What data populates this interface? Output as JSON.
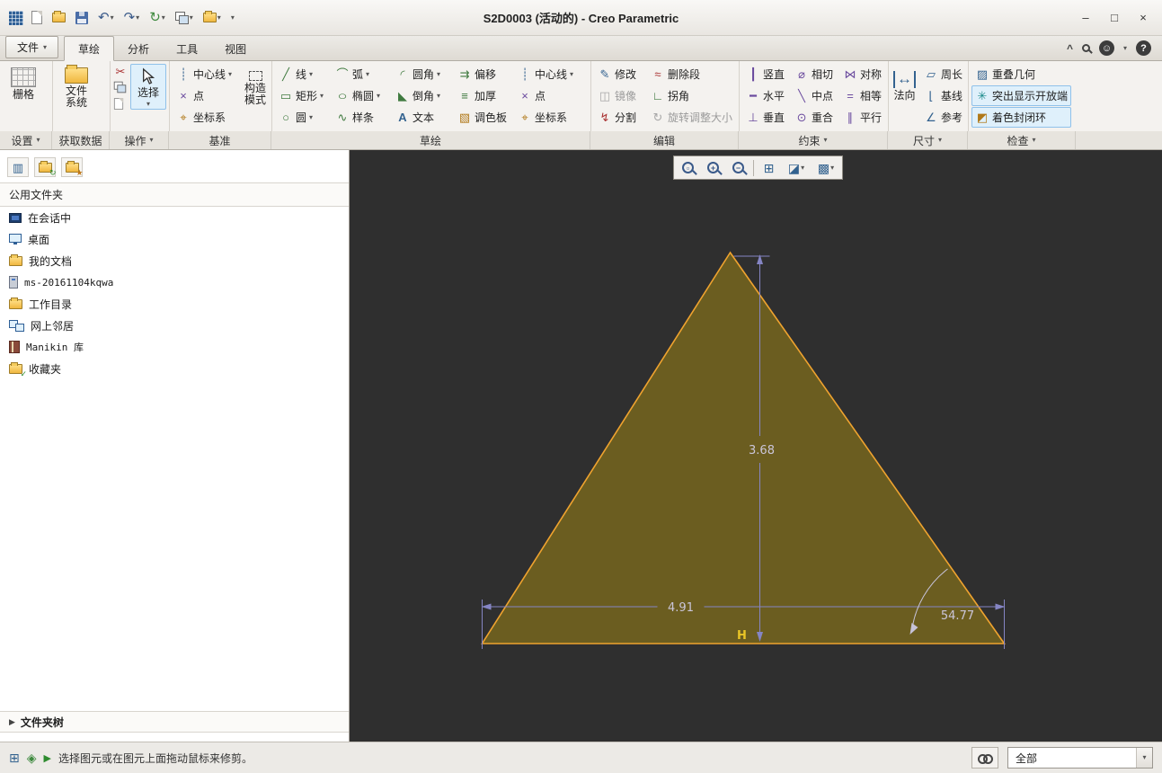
{
  "window": {
    "title": "S2D0003 (活动的) - Creo Parametric"
  },
  "icons": {
    "caret": "▾",
    "undo": "↶",
    "redo": "↷",
    "regen": "↻",
    "minimize": "–",
    "maximize": "□",
    "close": "×",
    "collapse": "^",
    "feedback": "☺",
    "help": "?",
    "cut": "✂",
    "centerline": "┊",
    "point": "×",
    "csys": "⌖",
    "line": "╱",
    "rect": "▭",
    "circle": "○",
    "arc": "⌒",
    "ellipse": "○",
    "spline": "∿",
    "fillet": "◜",
    "chamfer": "◣",
    "text": "A",
    "offset": "⇉",
    "thicken": "≡",
    "palette": "▧",
    "modify": "✎",
    "delete_segment": "≈",
    "mirror": "◫",
    "corner": "∟",
    "divide": "↯",
    "rotate_resize": "↻",
    "vertical": "┃",
    "horizontal": "━",
    "perpendicular": "⊥",
    "tangent": "⌀",
    "midpoint": "╲",
    "coincident": "⊙",
    "symmetric": "⋈",
    "equal": "=",
    "parallel": "∥",
    "normal": "↔",
    "perimeter": "▱",
    "baseline": "⌊",
    "reference": "∠",
    "overlap": "▨",
    "open_ends": "✳",
    "shade_loops": "◩",
    "browser_columns": "▥",
    "folder_refresh": "↻",
    "folder_star": "★",
    "zoom_region": "▫",
    "zoom_in": "+",
    "zoom_out": "−",
    "refit": "⊞",
    "display_style": "◪",
    "grid_display": "▩",
    "status_window": "⊞",
    "status_select": "◈",
    "message_arrow": "▶",
    "tree_caret": "▶"
  },
  "tabs": {
    "file": "文件",
    "sketch": "草绘",
    "analysis": "分析",
    "tools": "工具",
    "view": "视图"
  },
  "ribbon": {
    "labels": {
      "settings": "设置",
      "getdata": "获取数据",
      "operations": "操作",
      "datum": "基准",
      "sketch": "草绘",
      "edit": "编辑",
      "constrain": "约束",
      "dimension": "尺寸",
      "inspect": "检查"
    },
    "buttons": {
      "grid": "栅格",
      "filesystem": "文件系统",
      "select": "选择",
      "centerline": "中心线",
      "point": "点",
      "csys": "坐标系",
      "construction": "构造模式",
      "line": "线",
      "rect": "矩形",
      "circle": "圆",
      "arc": "弧",
      "ellipse": "椭圆",
      "spline": "样条",
      "fillet": "圆角",
      "chamfer": "倒角",
      "text": "文本",
      "offset": "偏移",
      "thicken": "加厚",
      "palette": "调色板",
      "modify": "修改",
      "delete_segment": "删除段",
      "mirror": "镜像",
      "corner": "拐角",
      "divide": "分割",
      "rotate_resize": "旋转调整大小",
      "vertical": "竖直",
      "tangent": "相切",
      "symmetric": "对称",
      "horizontal": "水平",
      "midpoint": "中点",
      "equal": "相等",
      "perpendicular": "垂直",
      "coincident": "重合",
      "parallel": "平行",
      "normal": "法向",
      "perimeter": "周长",
      "baseline": "基线",
      "reference": "参考",
      "overlap": "重叠几何",
      "open_ends": "突出显示开放端",
      "shade_loops": "着色封闭环"
    }
  },
  "browser": {
    "header": "公用文件夹",
    "items": [
      {
        "label": "在会话中"
      },
      {
        "label": "桌面"
      },
      {
        "label": "我的文档"
      },
      {
        "label": "ms-20161104kqwa"
      },
      {
        "label": "工作目录"
      },
      {
        "label": "网上邻居"
      },
      {
        "label": "Manikin 库"
      },
      {
        "label": "收藏夹"
      }
    ],
    "footer": "文件夹树"
  },
  "canvas": {
    "dims": {
      "height": "3.68",
      "width": "4.91",
      "angle": "54.77",
      "h": "H"
    },
    "colors": {
      "background": "#2f2f2f",
      "triangle_fill": "#6b5d20",
      "triangle_stroke": "#efa32f",
      "dimension_line": "#8585c4",
      "dimension_text": "#cbc6da",
      "constraint_text": "#e9c426"
    }
  },
  "statusbar": {
    "message": "选择图元或在图元上面拖动鼠标来修剪。",
    "filter": "全部"
  }
}
